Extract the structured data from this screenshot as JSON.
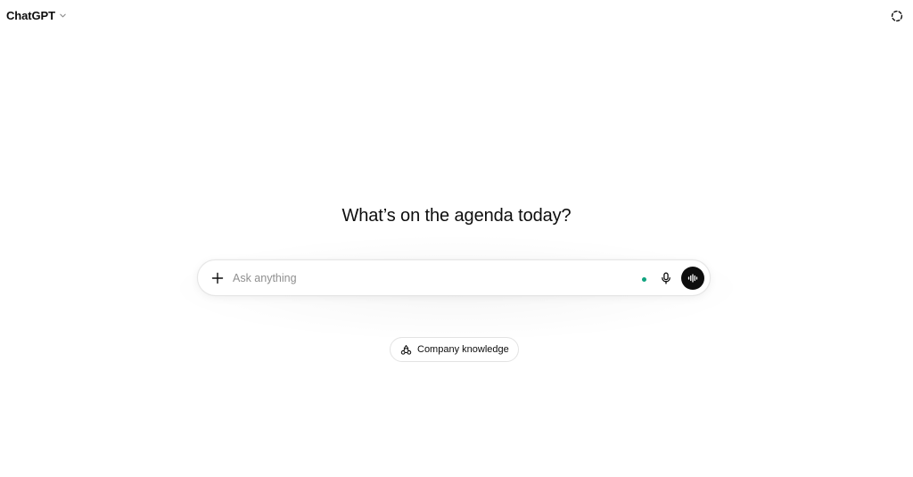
{
  "header": {
    "model_name": "ChatGPT",
    "model_chevron_icon": "chevron-down-icon",
    "temporary_chat_icon": "dashed-circle-icon"
  },
  "hero": {
    "title": "What’s on the agenda today?"
  },
  "composer": {
    "placeholder": "Ask anything",
    "value": "",
    "add_icon": "plus-icon",
    "status_dot_color": "#10a37f",
    "mic_icon": "microphone-icon",
    "voice_icon": "voice-waveform-icon"
  },
  "chips": [
    {
      "label": "Company knowledge",
      "icon": "company-knowledge-icon"
    }
  ],
  "colors": {
    "text": "#0d0d0d",
    "placeholder": "#8f8f8f",
    "border": "#e6e6e6",
    "voice_button_bg": "#0d0d0d"
  }
}
